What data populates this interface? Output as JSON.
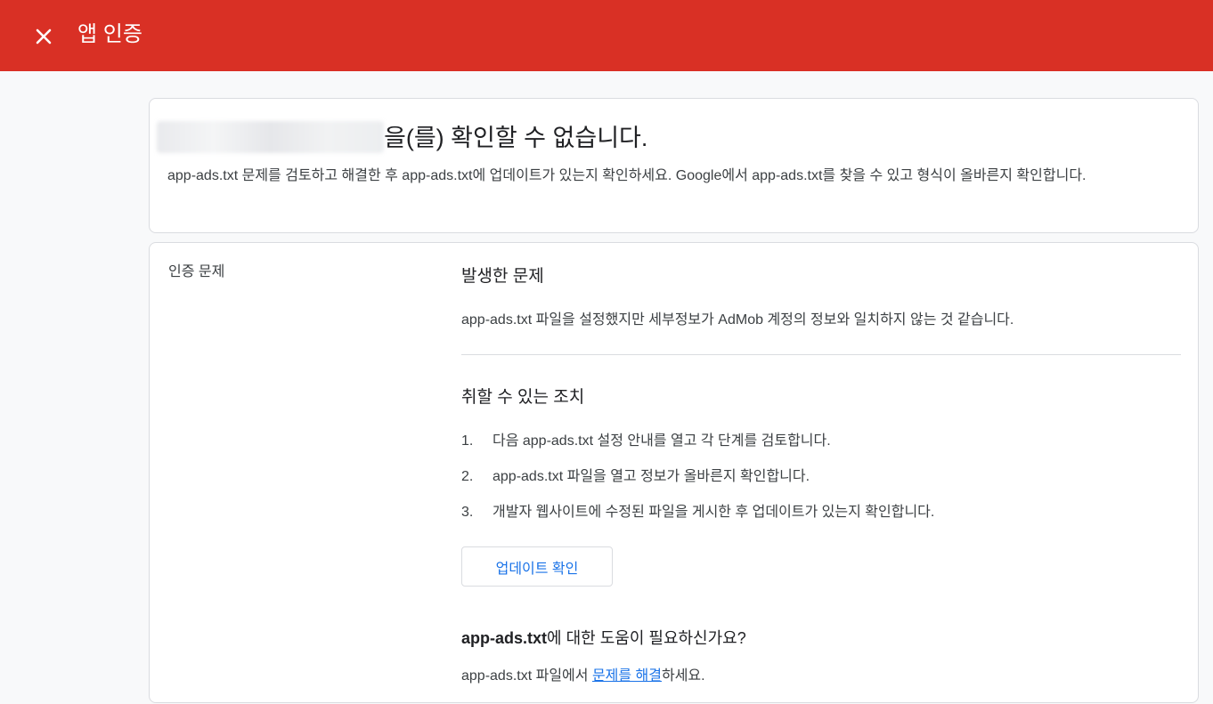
{
  "header": {
    "title": "앱 인증",
    "close_icon": "close-icon",
    "background_color": "#d93025"
  },
  "summary": {
    "headline_suffix": "을(를) 확인할 수 없습니다.",
    "description": "app-ads.txt 문제를 검토하고 해결한 후 app-ads.txt에 업데이트가 있는지 확인하세요. Google에서 app-ads.txt를 찾을 수 있고 형식이 올바른지 확인합니다."
  },
  "issue_section": {
    "label": "인증 문제",
    "issue_heading": "발생한 문제",
    "issue_text": "app-ads.txt 파일을 설정했지만 세부정보가 AdMob 계정의 정보와 일치하지 않는 것 같습니다.",
    "actions_heading": "취할 수 있는 조치",
    "steps": [
      {
        "num": "1.",
        "text": "다음 app-ads.txt 설정 안내를 열고 각 단계를 검토합니다."
      },
      {
        "num": "2.",
        "text": "app-ads.txt 파일을 열고 정보가 올바른지 확인합니다."
      },
      {
        "num": "3.",
        "text": "개발자 웹사이트에 수정된 파일을 게시한 후 업데이트가 있는지 확인합니다."
      }
    ],
    "check_button_label": "업데이트 확인",
    "help_heading_bold": "app-ads.txt",
    "help_heading_rest": "에 대한 도움이 필요하신가요?",
    "help_text_prefix": "app-ads.txt 파일에서 ",
    "help_link": "문제를 해결",
    "help_text_suffix": "하세요.",
    "link_color": "#1a73e8"
  }
}
